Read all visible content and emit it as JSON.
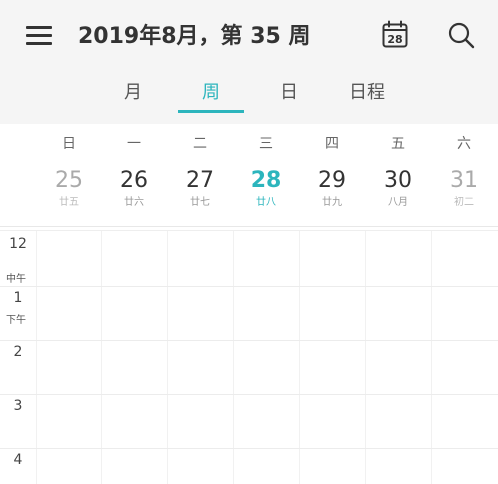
{
  "header": {
    "title": "2019年8月，第 35 周",
    "today_icon_day": "28"
  },
  "tabs": [
    {
      "label": "月"
    },
    {
      "label": "周",
      "active": true
    },
    {
      "label": "日"
    },
    {
      "label": "日程"
    }
  ],
  "week": {
    "days": [
      {
        "weekday": "日",
        "date": "25",
        "lunar": "廿五"
      },
      {
        "weekday": "一",
        "date": "26",
        "lunar": "廿六"
      },
      {
        "weekday": "二",
        "date": "27",
        "lunar": "廿七"
      },
      {
        "weekday": "三",
        "date": "28",
        "lunar": "廿八",
        "today": true
      },
      {
        "weekday": "四",
        "date": "29",
        "lunar": "廿九"
      },
      {
        "weekday": "五",
        "date": "30",
        "lunar": "八月"
      },
      {
        "weekday": "六",
        "date": "31",
        "lunar": "初二"
      }
    ]
  },
  "timeline": {
    "hours": [
      "12",
      "1",
      "2",
      "3",
      "4"
    ],
    "noon_label": "中午",
    "pm_label": "下午"
  },
  "colors": {
    "accent": "#2cb5bd",
    "header_bg": "#f5f5f5"
  },
  "icons": {
    "menu": "hamburger-menu-icon",
    "today": "calendar-today-icon",
    "search": "search-icon"
  }
}
